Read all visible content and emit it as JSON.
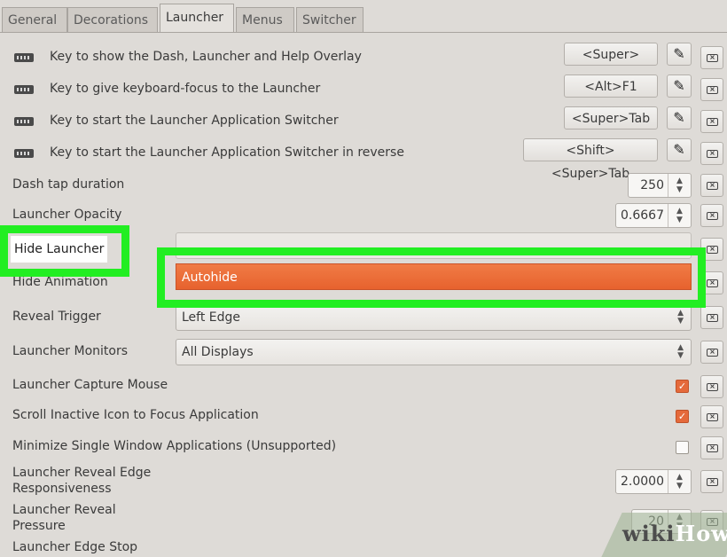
{
  "tabs": [
    "General",
    "Decorations",
    "Launcher",
    "Menus",
    "Switcher"
  ],
  "active_tab": "Launcher",
  "keybindings": [
    {
      "label": "Key to show the Dash, Launcher and Help Overlay",
      "value": "<Super>"
    },
    {
      "label": "Key to give keyboard-focus to the Launcher",
      "value": "<Alt>F1"
    },
    {
      "label": "Key to start the Launcher Application Switcher",
      "value": "<Super>Tab"
    },
    {
      "label": "Key to start the Launcher Application Switcher in reverse",
      "value": "<Shift><Super>Tab"
    }
  ],
  "dash_tap": {
    "label": "Dash tap duration",
    "value": "250"
  },
  "opacity": {
    "label": "Launcher Opacity",
    "value": "0.6667"
  },
  "hide_launcher": {
    "label": "Hide Launcher"
  },
  "hide_animation": {
    "label": "Hide Animation"
  },
  "dropdown_selected": "Autohide",
  "reveal_trigger": {
    "label": "Reveal Trigger",
    "value": "Left Edge"
  },
  "monitors": {
    "label": "Launcher Monitors",
    "value": "All Displays"
  },
  "capture_mouse": {
    "label": "Launcher Capture Mouse",
    "checked": true
  },
  "scroll_inactive": {
    "label": "Scroll Inactive Icon to Focus Application",
    "checked": true
  },
  "minimize_single": {
    "label": "Minimize Single Window Applications (Unsupported)",
    "checked": false
  },
  "reveal_edge": {
    "label_line1": "Launcher Reveal Edge",
    "label_line2": "Responsiveness",
    "value": "2.0000"
  },
  "reveal_pressure": {
    "label_line1": "Launcher Reveal",
    "label_line2": "Pressure",
    "value": "20"
  },
  "edge_stop": {
    "label": "Launcher Edge Stop"
  },
  "watermark": {
    "part1": "wiki",
    "part2": "How"
  },
  "icons": {
    "keyboard": "keyboard-icon",
    "edit": "pencil-icon",
    "clear": "clear-icon",
    "check": "✓"
  },
  "colors": {
    "highlight": "#22ee22",
    "accent": "#e7622e"
  }
}
